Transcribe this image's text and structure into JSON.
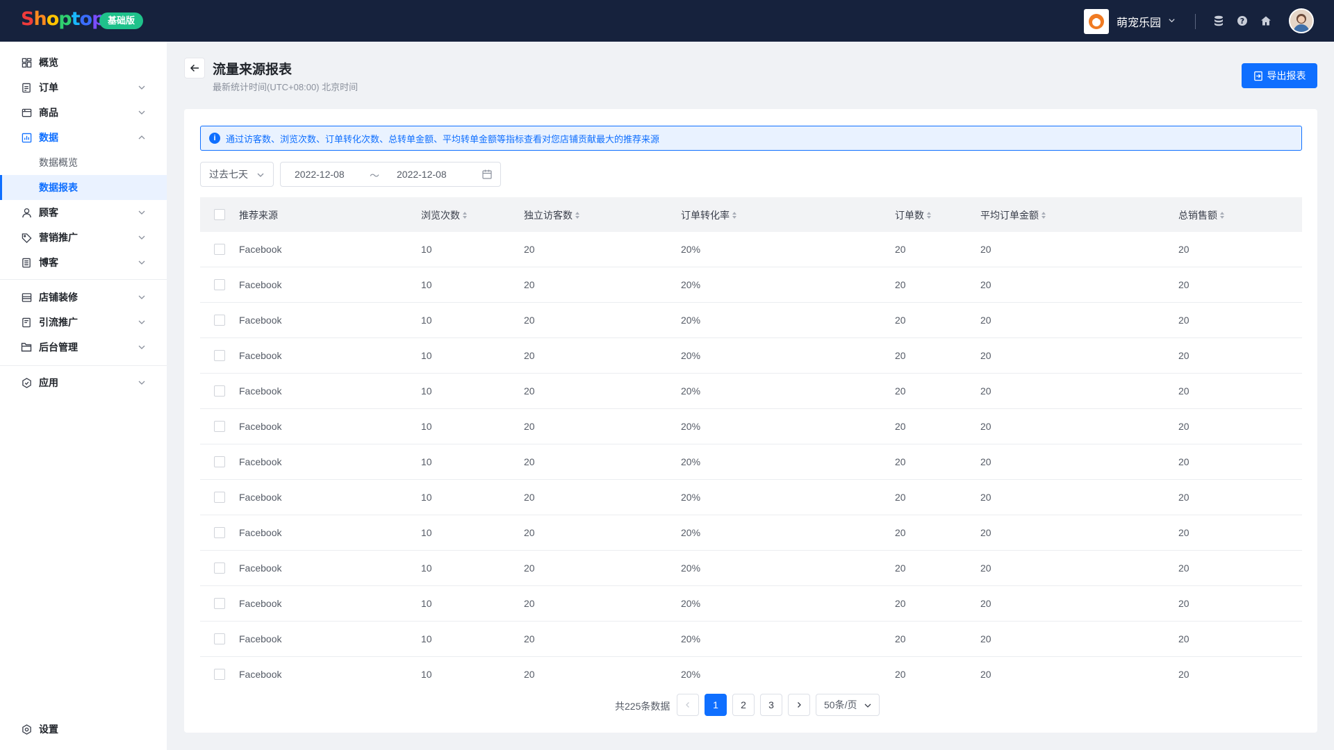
{
  "brand": {
    "logo_letters": [
      "S",
      "h",
      "o",
      "p",
      "t",
      "o",
      "p"
    ],
    "logo_colors": [
      "#ef3b3b",
      "#ff8a1f",
      "#ffc400",
      "#2fcf6f",
      "#1ab7ff",
      "#3a6dff",
      "#7b4dff"
    ],
    "plan": "基础版"
  },
  "header": {
    "store_name": "萌宠乐园",
    "icons": [
      "database-icon",
      "help-icon",
      "home-icon"
    ]
  },
  "sidebar": {
    "items": [
      {
        "label": "概览",
        "icon": "dashboard-icon"
      },
      {
        "label": "订单",
        "icon": "order-icon"
      },
      {
        "label": "商品",
        "icon": "product-icon"
      },
      {
        "label": "数据",
        "icon": "data-icon"
      },
      {
        "label": "顾客",
        "icon": "customer-icon"
      },
      {
        "label": "营销推广",
        "icon": "tag-icon"
      },
      {
        "label": "博客",
        "icon": "blog-icon"
      },
      {
        "label": "店铺装修",
        "icon": "store-icon"
      },
      {
        "label": "引流推广",
        "icon": "traffic-icon"
      },
      {
        "label": "后台管理",
        "icon": "folder-icon"
      },
      {
        "label": "应用",
        "icon": "app-icon"
      }
    ],
    "sub_items": [
      "数据概览",
      "数据报表"
    ],
    "settings": "设置"
  },
  "page": {
    "title": "流量来源报表",
    "subtitle": "最新统计时间(UTC+08:00) 北京时间",
    "export_label": "导出报表"
  },
  "notice": "通过访客数、浏览次数、订单转化次数、总转单金额、平均转单金额等指标查看对您店铺贡献最大的推荐来源",
  "filters": {
    "range": "过去七天",
    "start": "2022-12-08",
    "separator": "～",
    "end": "2022-12-08"
  },
  "table": {
    "columns": [
      "推荐来源",
      "浏览次数",
      "独立访客数",
      "订单转化率",
      "订单数",
      "平均订单金额",
      "总销售额"
    ],
    "rows": [
      [
        "Facebook",
        "10",
        "20",
        "20%",
        "20",
        "20",
        "20"
      ],
      [
        "Facebook",
        "10",
        "20",
        "20%",
        "20",
        "20",
        "20"
      ],
      [
        "Facebook",
        "10",
        "20",
        "20%",
        "20",
        "20",
        "20"
      ],
      [
        "Facebook",
        "10",
        "20",
        "20%",
        "20",
        "20",
        "20"
      ],
      [
        "Facebook",
        "10",
        "20",
        "20%",
        "20",
        "20",
        "20"
      ],
      [
        "Facebook",
        "10",
        "20",
        "20%",
        "20",
        "20",
        "20"
      ],
      [
        "Facebook",
        "10",
        "20",
        "20%",
        "20",
        "20",
        "20"
      ],
      [
        "Facebook",
        "10",
        "20",
        "20%",
        "20",
        "20",
        "20"
      ],
      [
        "Facebook",
        "10",
        "20",
        "20%",
        "20",
        "20",
        "20"
      ],
      [
        "Facebook",
        "10",
        "20",
        "20%",
        "20",
        "20",
        "20"
      ],
      [
        "Facebook",
        "10",
        "20",
        "20%",
        "20",
        "20",
        "20"
      ],
      [
        "Facebook",
        "10",
        "20",
        "20%",
        "20",
        "20",
        "20"
      ],
      [
        "Facebook",
        "10",
        "20",
        "20%",
        "20",
        "20",
        "20"
      ]
    ]
  },
  "pagination": {
    "total": "共225条数据",
    "pages": [
      "1",
      "2",
      "3"
    ],
    "current": "1",
    "page_size": "50条/页"
  },
  "colors": {
    "topbar": "#16223d",
    "accent": "#0f6fff",
    "badge": "#1fc28b"
  }
}
